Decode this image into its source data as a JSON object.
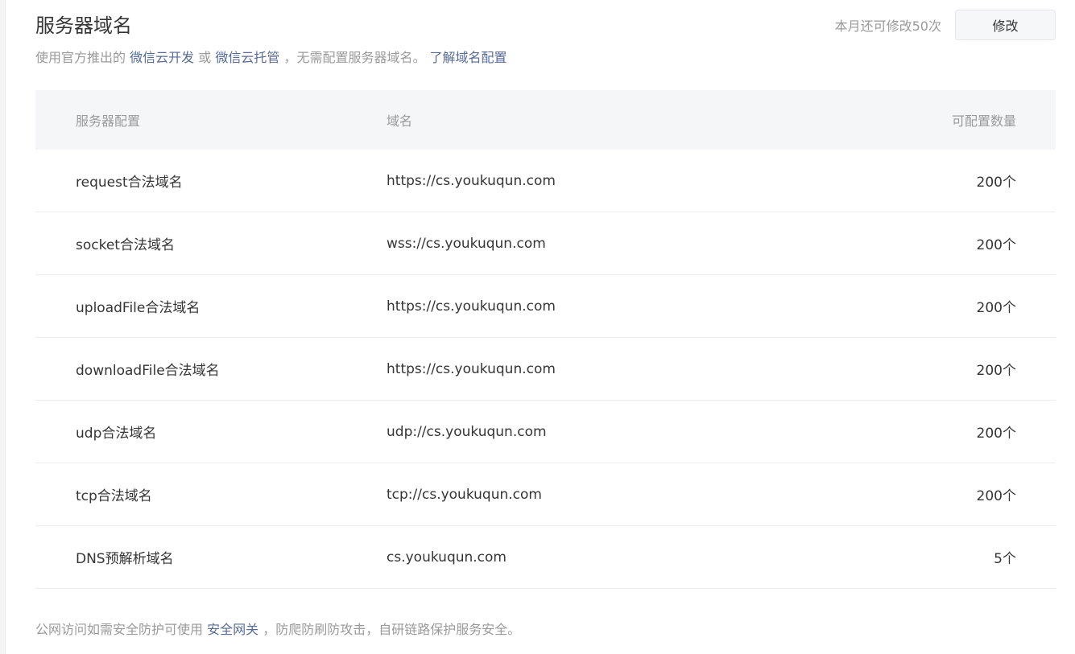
{
  "header": {
    "title": "服务器域名",
    "subtitle_prefix": "使用官方推出的",
    "link_cloud_dev": "微信云开发",
    "or_text": "或",
    "link_cloud_hosting": "微信云托管",
    "subtitle_suffix": "，无需配置服务器域名。",
    "learn_link": "了解域名配置",
    "quota_text": "本月还可修改50次",
    "edit_label": "修改"
  },
  "table": {
    "headers": [
      "服务器配置",
      "域名",
      "可配置数量"
    ],
    "rows": [
      {
        "config": "request合法域名",
        "domain": "https://cs.youkuqun.com",
        "count": "200个"
      },
      {
        "config": "socket合法域名",
        "domain": "wss://cs.youkuqun.com",
        "count": "200个"
      },
      {
        "config": "uploadFile合法域名",
        "domain": "https://cs.youkuqun.com",
        "count": "200个"
      },
      {
        "config": "downloadFile合法域名",
        "domain": "https://cs.youkuqun.com",
        "count": "200个"
      },
      {
        "config": "udp合法域名",
        "domain": "udp://cs.youkuqun.com",
        "count": "200个"
      },
      {
        "config": "tcp合法域名",
        "domain": "tcp://cs.youkuqun.com",
        "count": "200个"
      },
      {
        "config": "DNS预解析域名",
        "domain": "cs.youkuqun.com",
        "count": "5个"
      }
    ]
  },
  "footer": {
    "prefix": "公网访问如需安全防护可使用",
    "link": "安全网关",
    "suffix": "，防爬防刷防攻击，自研链路保护服务安全。"
  },
  "colors": {
    "link": "#576b95",
    "muted": "#9a9a9a",
    "text": "#353535",
    "header_bg": "#f5f6f8"
  }
}
